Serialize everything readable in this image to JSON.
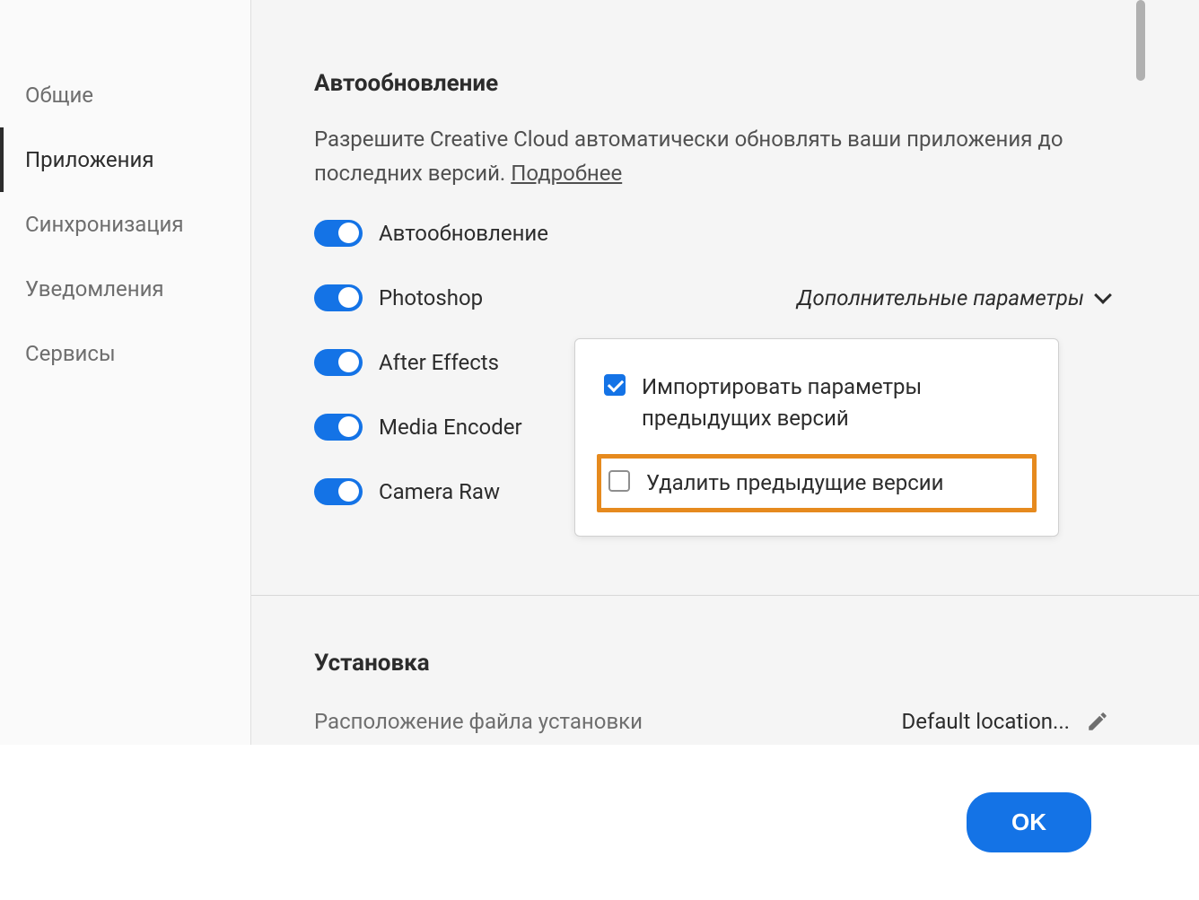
{
  "sidebar": {
    "items": [
      {
        "label": "Общие"
      },
      {
        "label": "Приложения"
      },
      {
        "label": "Синхронизация"
      },
      {
        "label": "Уведомления"
      },
      {
        "label": "Сервисы"
      }
    ]
  },
  "autoupdate": {
    "title": "Автообновление",
    "description_prefix": "Разрешите Creative Cloud автоматически обновлять ваши приложения до последних версий. ",
    "more_link": "Подробнее",
    "master_toggle_label": "Автообновление",
    "apps": [
      {
        "label": "Photoshop"
      },
      {
        "label": "After Effects"
      },
      {
        "label": "Media Encoder"
      },
      {
        "label": "Camera Raw"
      }
    ],
    "advanced_label": "Дополнительные параметры",
    "popup": {
      "import_label": "Импортировать параметры предыдущих версий",
      "remove_label": "Удалить предыдущие версии"
    }
  },
  "install": {
    "title": "Установка",
    "location_label": "Расположение файла установки",
    "location_value": "Default location..."
  },
  "footer": {
    "ok_label": "OK"
  }
}
